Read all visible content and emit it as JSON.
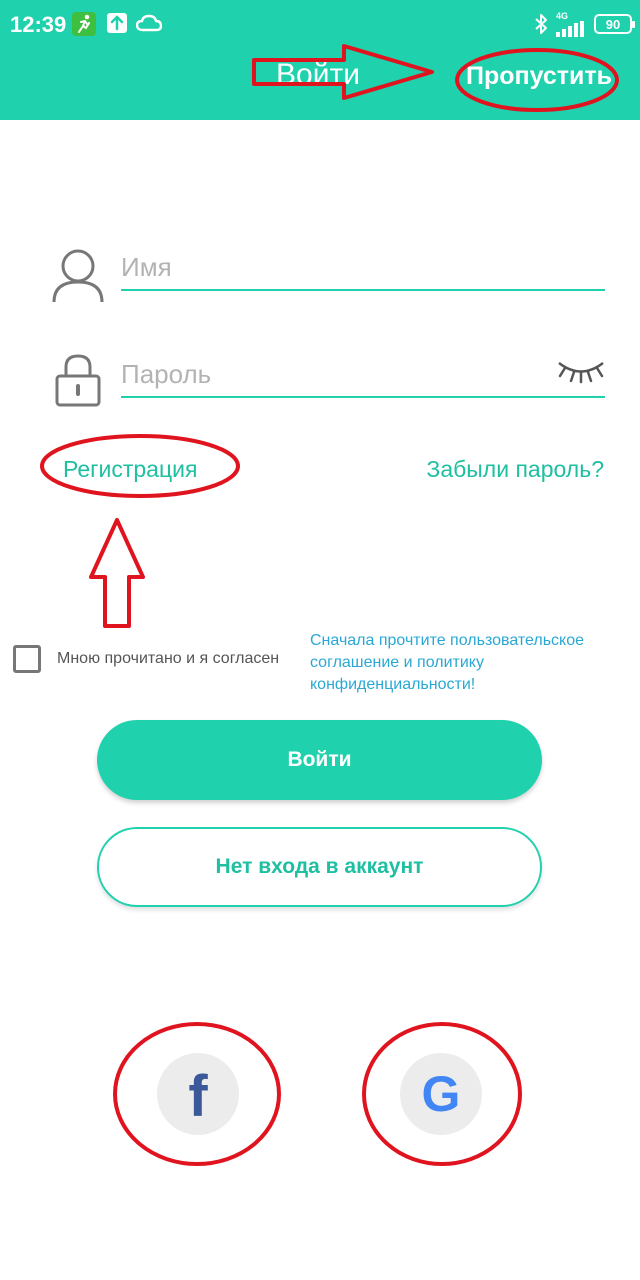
{
  "status_bar": {
    "time": "12:39",
    "network": "4G",
    "battery": "90"
  },
  "header": {
    "title": "Войти",
    "skip_label": "Пропустить"
  },
  "form": {
    "name_placeholder": "Имя",
    "password_placeholder": "Пароль",
    "register_label": "Регистрация",
    "forgot_label": "Забыли пароль?"
  },
  "agreement": {
    "label": "Мною прочитано и я согласен",
    "note": "Сначала прочтите пользовательское соглашение и политику конфиденциальности!"
  },
  "buttons": {
    "login_label": "Войти",
    "guest_label": "Нет входа в аккаунт"
  },
  "social": {
    "facebook_letter": "f",
    "google_letter": "G"
  },
  "colors": {
    "accent": "#1fd1ac",
    "link": "#1fbfa2",
    "note": "#2aa8d4",
    "annotation": "#e0141e"
  }
}
